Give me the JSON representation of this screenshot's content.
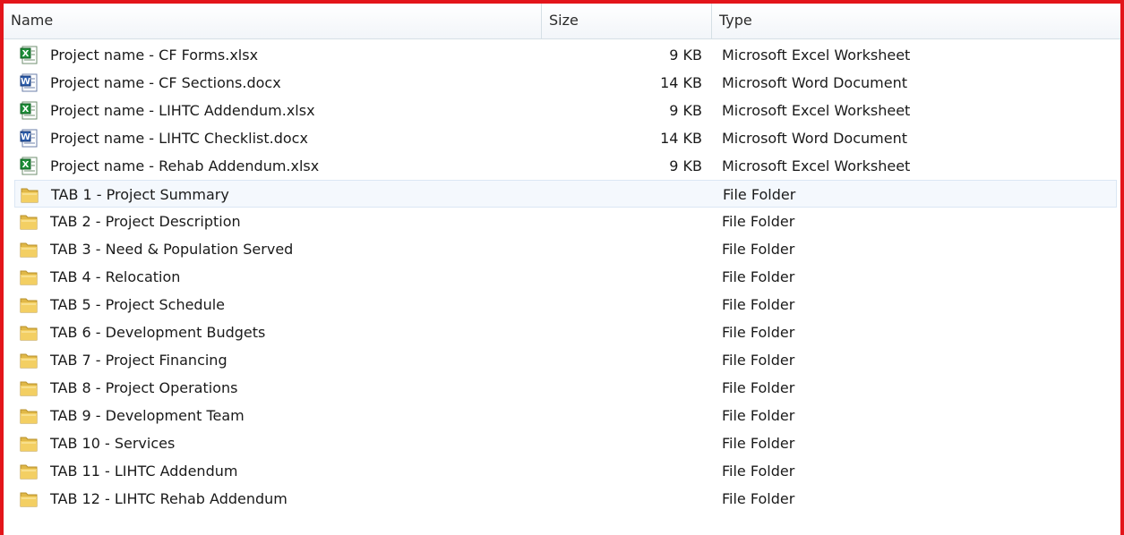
{
  "columns": {
    "name": "Name",
    "size": "Size",
    "type": "Type"
  },
  "icons": {
    "excel": "excel-file-icon",
    "word": "word-file-icon",
    "folder": "folder-icon"
  },
  "colors": {
    "frame": "#e3151a",
    "hover_row": "#f4f8fd"
  },
  "rows": [
    {
      "name": "Project name - CF Forms.xlsx",
      "size": "9 KB",
      "type": "Microsoft Excel Worksheet",
      "icon": "excel"
    },
    {
      "name": "Project name - CF Sections.docx",
      "size": "14 KB",
      "type": "Microsoft Word Document",
      "icon": "word"
    },
    {
      "name": "Project name - LIHTC Addendum.xlsx",
      "size": "9 KB",
      "type": "Microsoft Excel Worksheet",
      "icon": "excel"
    },
    {
      "name": "Project name - LIHTC Checklist.docx",
      "size": "14 KB",
      "type": "Microsoft Word Document",
      "icon": "word"
    },
    {
      "name": "Project name - Rehab Addendum.xlsx",
      "size": "9 KB",
      "type": "Microsoft Excel Worksheet",
      "icon": "excel"
    },
    {
      "name": "TAB 1 - Project Summary",
      "size": "",
      "type": "File Folder",
      "icon": "folder"
    },
    {
      "name": "TAB 2 - Project Description",
      "size": "",
      "type": "File Folder",
      "icon": "folder"
    },
    {
      "name": "TAB 3 - Need & Population Served",
      "size": "",
      "type": "File Folder",
      "icon": "folder"
    },
    {
      "name": "TAB 4 - Relocation",
      "size": "",
      "type": "File Folder",
      "icon": "folder"
    },
    {
      "name": "TAB 5 - Project Schedule",
      "size": "",
      "type": "File Folder",
      "icon": "folder"
    },
    {
      "name": "TAB 6 - Development Budgets",
      "size": "",
      "type": "File Folder",
      "icon": "folder"
    },
    {
      "name": "TAB 7 - Project Financing",
      "size": "",
      "type": "File Folder",
      "icon": "folder"
    },
    {
      "name": "TAB 8 - Project Operations",
      "size": "",
      "type": "File Folder",
      "icon": "folder"
    },
    {
      "name": "TAB 9 - Development Team",
      "size": "",
      "type": "File Folder",
      "icon": "folder"
    },
    {
      "name": "TAB 10 - Services",
      "size": "",
      "type": "File Folder",
      "icon": "folder"
    },
    {
      "name": "TAB 11 - LIHTC Addendum",
      "size": "",
      "type": "File Folder",
      "icon": "folder"
    },
    {
      "name": "TAB 12 - LIHTC Rehab Addendum",
      "size": "",
      "type": "File Folder",
      "icon": "folder"
    }
  ],
  "hovered_row": 5
}
